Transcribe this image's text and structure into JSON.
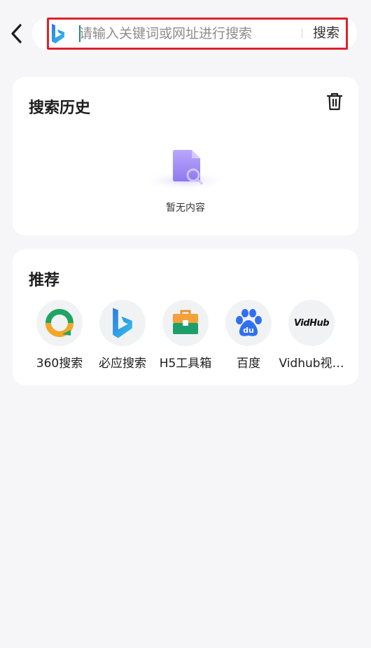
{
  "search": {
    "placeholder": "请输入关键词或网址进行搜索",
    "value": "",
    "button_label": "搜索",
    "engine_icon": "bing-icon"
  },
  "history": {
    "title": "搜索历史",
    "empty_text": "暂无内容"
  },
  "recommend": {
    "title": "推荐",
    "items": [
      {
        "label": "360搜索",
        "icon": "360-search-icon"
      },
      {
        "label": "必应搜索",
        "icon": "bing-icon"
      },
      {
        "label": "H5工具箱",
        "icon": "toolbox-icon"
      },
      {
        "label": "百度",
        "icon": "baidu-paw-icon"
      },
      {
        "label": "Vidhub视…",
        "icon": "vidhub-logo",
        "logo_text": "VidHub"
      }
    ]
  },
  "colors": {
    "highlight": "#e0202a",
    "caret": "#1a8a80",
    "baidu": "#2f6ff2",
    "bing_blue": "#1e90ff",
    "green": "#1fa463",
    "orange": "#f5a623"
  }
}
